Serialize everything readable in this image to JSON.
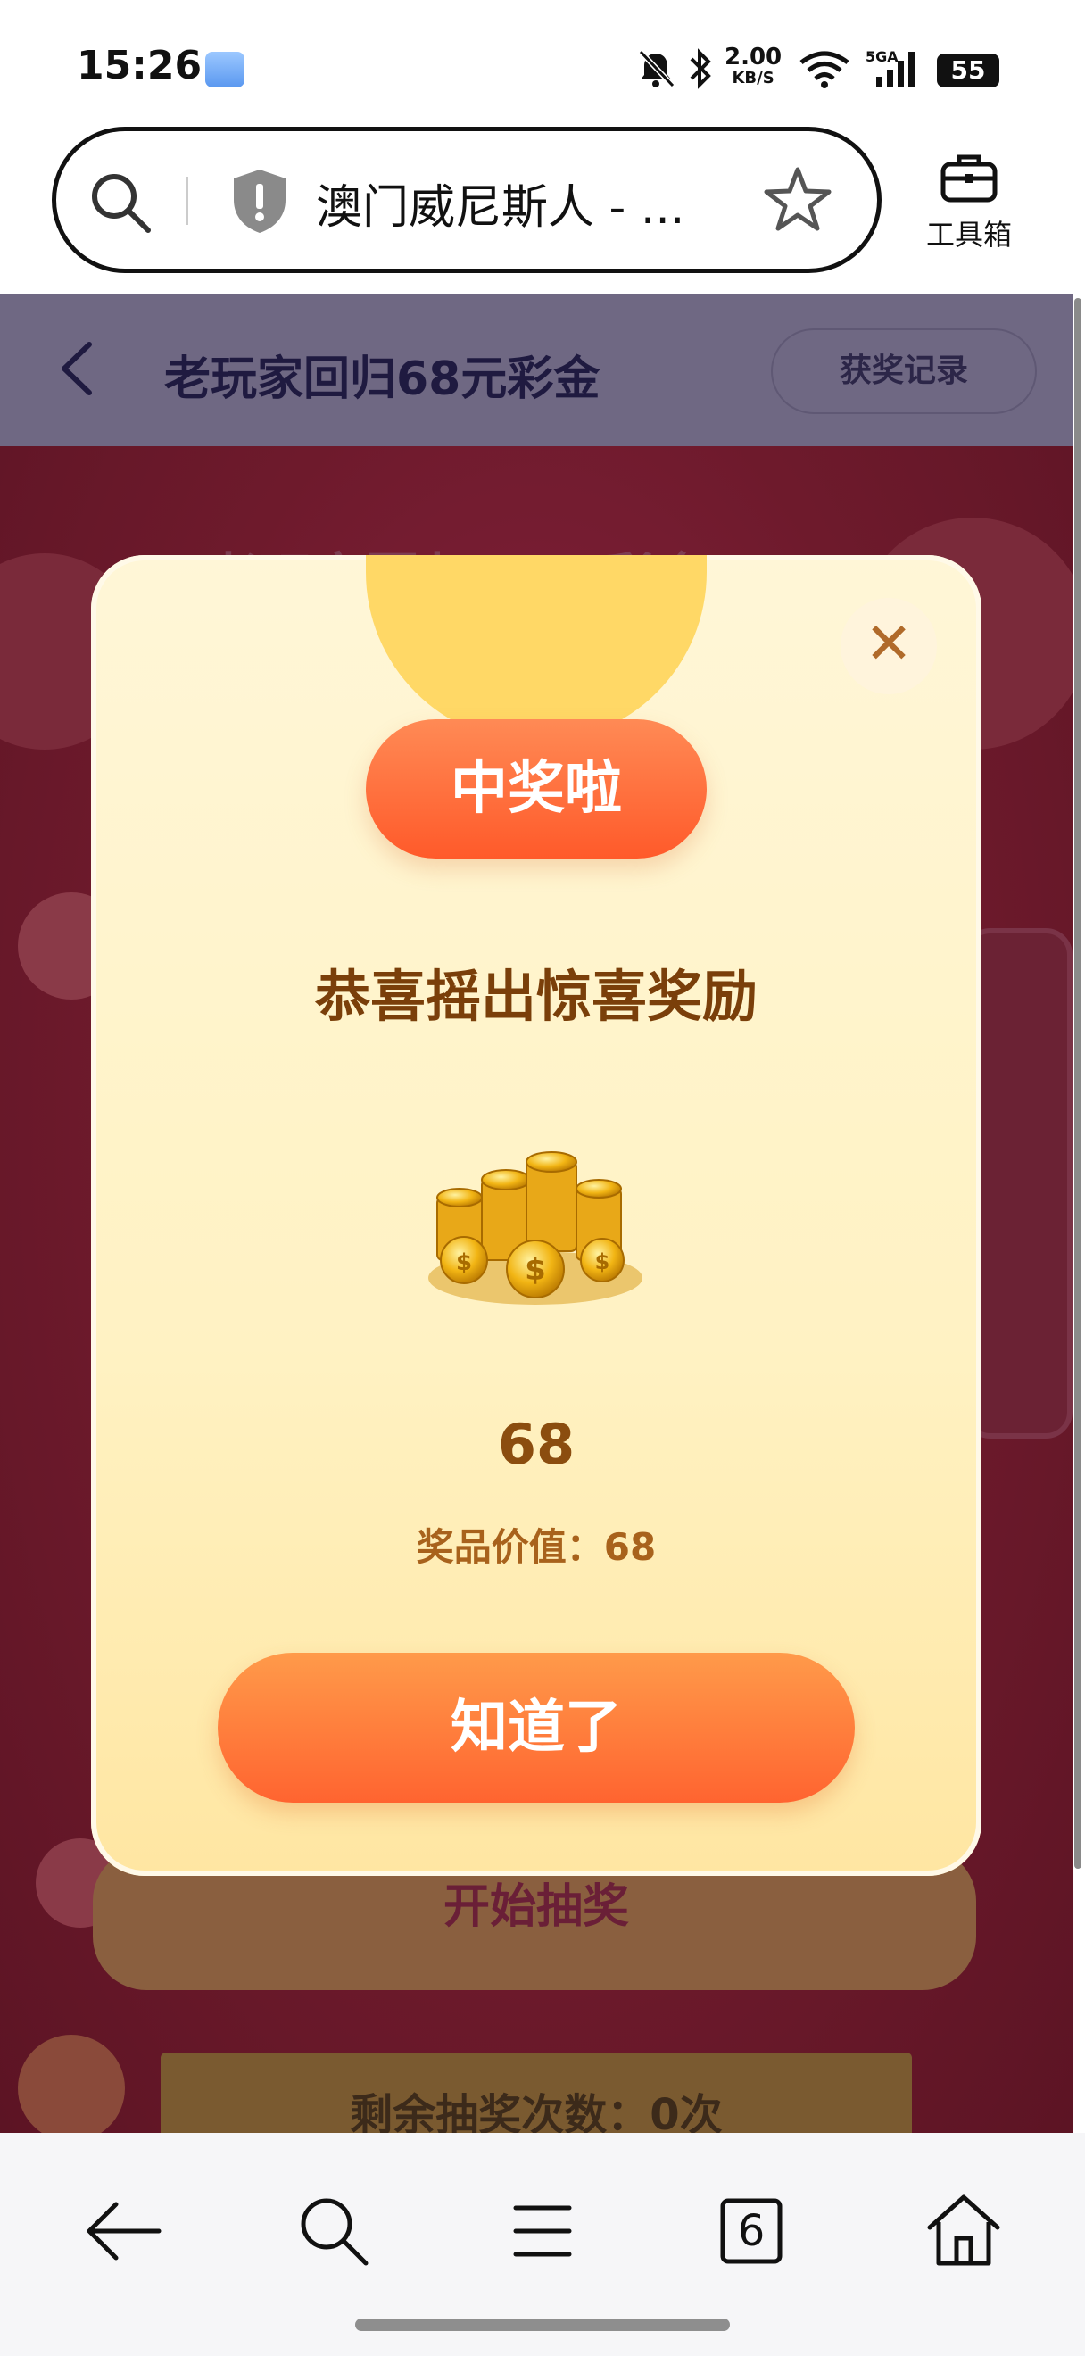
{
  "status_bar": {
    "time": "15:26",
    "net_speed_value": "2.00",
    "net_speed_unit": "KB/S",
    "signal_label": "5GA",
    "battery": "55"
  },
  "browser": {
    "address_title": "澳门威尼斯人 - ...",
    "toolbox_label": "工具箱",
    "tab_count": "6"
  },
  "page": {
    "title": "老玩家回归68元彩金",
    "record_button": "获奖记录",
    "ghost_title": "老玩家回归68元彩金",
    "draw_button": "开始抽奖",
    "remaining_text": "剩余抽奖次数：0次"
  },
  "modal": {
    "badge": "中奖啦",
    "congrats": "恭喜摇出惊喜奖励",
    "prize_amount": "68",
    "prize_value": "奖品价值：68",
    "ok_button": "知道了",
    "close_icon": "close-icon"
  },
  "colors": {
    "accent_orange": "#ff6430",
    "modal_bg": "#fff2c3",
    "badge_yellow": "#ffd866"
  }
}
